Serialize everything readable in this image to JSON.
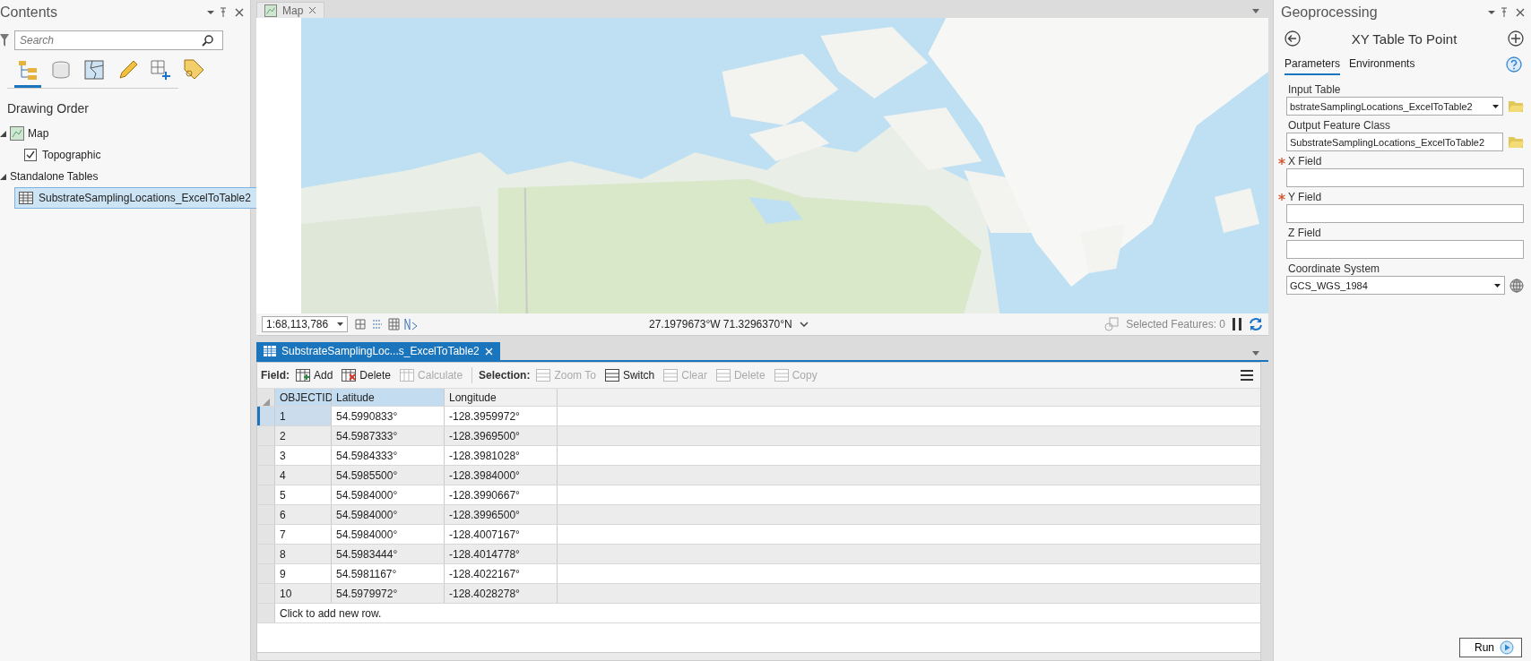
{
  "contents": {
    "title": "Contents",
    "search": {
      "placeholder": "Search"
    },
    "view_tabs": [
      {
        "kind": "order",
        "selected": true
      },
      {
        "kind": "source",
        "selected": false
      },
      {
        "kind": "selection",
        "selected": false
      },
      {
        "kind": "editing",
        "selected": false
      },
      {
        "kind": "snapping",
        "selected": false
      },
      {
        "kind": "labeling",
        "selected": false
      }
    ],
    "heading": "Drawing Order",
    "tree": [
      {
        "label": "Map",
        "kind": "map",
        "expanded": true,
        "children": [
          {
            "label": "Topographic",
            "kind": "layer",
            "checked": true
          }
        ]
      },
      {
        "label": "Standalone Tables",
        "kind": "group",
        "expanded": true,
        "children": [
          {
            "label": "SubstrateSamplingLocations_ExcelToTable2",
            "kind": "table",
            "selected": true
          }
        ]
      }
    ]
  },
  "map_view": {
    "tab": "Map",
    "scale": "1:68,113,786",
    "coordinates": "27.1979673°W 71.3296370°N",
    "selected_features": "Selected Features: 0"
  },
  "table_view": {
    "tab": "SubstrateSamplingLoc...s_ExcelToTable2",
    "field_label": "Field:",
    "field_tools": [
      {
        "label": "Add",
        "disabled": false
      },
      {
        "label": "Delete",
        "disabled": false
      },
      {
        "label": "Calculate",
        "disabled": true
      }
    ],
    "selection_label": "Selection:",
    "selection_tools": [
      {
        "label": "Zoom To",
        "disabled": true
      },
      {
        "label": "Switch",
        "disabled": false
      },
      {
        "label": "Clear",
        "disabled": true
      },
      {
        "label": "Delete",
        "disabled": true
      },
      {
        "label": "Copy",
        "disabled": true
      }
    ],
    "columns": [
      "OBJECTID",
      "Latitude",
      "Longitude"
    ],
    "rows": [
      {
        "cells": [
          "1",
          "54.5990833°",
          "-128.3959972°"
        ],
        "selected": true
      },
      {
        "cells": [
          "2",
          "54.5987333°",
          "-128.3969500°"
        ],
        "selected": false
      },
      {
        "cells": [
          "3",
          "54.5984333°",
          "-128.3981028°"
        ],
        "selected": false
      },
      {
        "cells": [
          "4",
          "54.5985500°",
          "-128.3984000°"
        ],
        "selected": false
      },
      {
        "cells": [
          "5",
          "54.5984000°",
          "-128.3990667°"
        ],
        "selected": false
      },
      {
        "cells": [
          "6",
          "54.5984000°",
          "-128.3996500°"
        ],
        "selected": false
      },
      {
        "cells": [
          "7",
          "54.5984000°",
          "-128.4007167°"
        ],
        "selected": false
      },
      {
        "cells": [
          "8",
          "54.5983444°",
          "-128.4014778°"
        ],
        "selected": false
      },
      {
        "cells": [
          "9",
          "54.5981167°",
          "-128.4022167°"
        ],
        "selected": false
      },
      {
        "cells": [
          "10",
          "54.5979972°",
          "-128.4028278°"
        ],
        "selected": false
      }
    ],
    "add_row": "Click to add new row."
  },
  "geoprocessing": {
    "title": "Geoprocessing",
    "tool": "XY Table To Point",
    "tabs": [
      {
        "label": "Parameters",
        "selected": true
      },
      {
        "label": "Environments",
        "selected": false
      }
    ],
    "params": [
      {
        "label": "Input Table",
        "kind": "dropdown",
        "value": "bstrateSamplingLocations_ExcelToTable2",
        "browse": true
      },
      {
        "label": "Output Feature Class",
        "kind": "text",
        "value": "SubstrateSamplingLocations_ExcelToTable2",
        "browse": true
      },
      {
        "label": "X Field",
        "kind": "text",
        "required": true
      },
      {
        "label": "Y Field",
        "kind": "text",
        "required": true
      },
      {
        "label": "Z Field",
        "kind": "text"
      },
      {
        "label": "Coordinate System",
        "kind": "dropdown",
        "value": "GCS_WGS_1984",
        "globe": true
      }
    ],
    "run": "Run"
  }
}
